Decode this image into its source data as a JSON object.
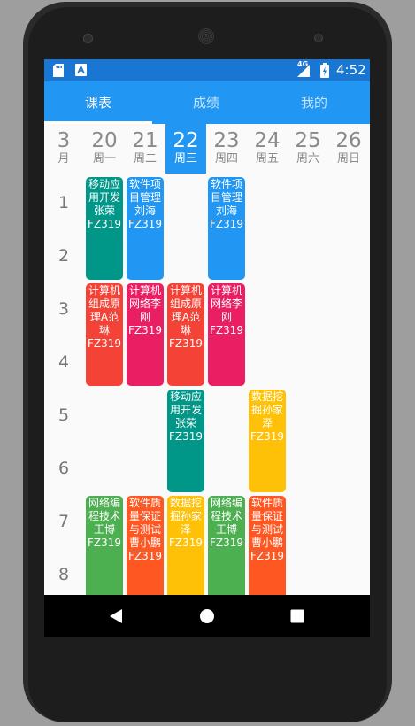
{
  "status": {
    "net": "4G",
    "time": "4:52"
  },
  "tabs": [
    {
      "label": "课表"
    },
    {
      "label": "成绩"
    },
    {
      "label": "我的"
    }
  ],
  "month": {
    "num": "3",
    "label": "月"
  },
  "days": [
    {
      "num": "20",
      "label": "周一"
    },
    {
      "num": "21",
      "label": "周二"
    },
    {
      "num": "22",
      "label": "周三"
    },
    {
      "num": "23",
      "label": "周四"
    },
    {
      "num": "24",
      "label": "周五"
    },
    {
      "num": "25",
      "label": "周六"
    },
    {
      "num": "26",
      "label": "周日"
    }
  ],
  "sections": [
    "1",
    "2",
    "3",
    "4",
    "5",
    "6",
    "7",
    "8"
  ],
  "courses": [
    {
      "day": 0,
      "start": 1,
      "span": 2,
      "text": "移动应用开发张荣FZ319",
      "color": "#009688"
    },
    {
      "day": 1,
      "start": 1,
      "span": 2,
      "text": "软件项目管理刘海FZ319",
      "color": "#2196f3"
    },
    {
      "day": 3,
      "start": 1,
      "span": 2,
      "text": "软件项目管理刘海FZ319",
      "color": "#2196f3"
    },
    {
      "day": 0,
      "start": 3,
      "span": 2,
      "text": "计算机组成原理A范琳FZ319",
      "color": "#f44336"
    },
    {
      "day": 1,
      "start": 3,
      "span": 2,
      "text": "计算机网络李刚FZ319",
      "color": "#e91e63"
    },
    {
      "day": 2,
      "start": 3,
      "span": 2,
      "text": "计算机组成原理A范琳FZ319",
      "color": "#f44336"
    },
    {
      "day": 3,
      "start": 3,
      "span": 2,
      "text": "计算机网络李刚FZ319",
      "color": "#e91e63"
    },
    {
      "day": 2,
      "start": 5,
      "span": 2,
      "text": "移动应用开发张荣FZ319",
      "color": "#009688"
    },
    {
      "day": 4,
      "start": 5,
      "span": 2,
      "text": "数据挖掘孙家泽FZ319",
      "color": "#ffc107"
    },
    {
      "day": 0,
      "start": 7,
      "span": 2,
      "text": "网络编程技术王博FZ319",
      "color": "#4caf50"
    },
    {
      "day": 1,
      "start": 7,
      "span": 2,
      "text": "软件质量保证与测试曹小鹏FZ319",
      "color": "#ff5722"
    },
    {
      "day": 2,
      "start": 7,
      "span": 2,
      "text": "数据挖掘孙家泽FZ319",
      "color": "#ffc107"
    },
    {
      "day": 3,
      "start": 7,
      "span": 2,
      "text": "网络编程技术王博FZ319",
      "color": "#4caf50"
    },
    {
      "day": 4,
      "start": 7,
      "span": 2,
      "text": "软件质量保证与测试曹小鹏FZ319",
      "color": "#ff5722"
    }
  ]
}
